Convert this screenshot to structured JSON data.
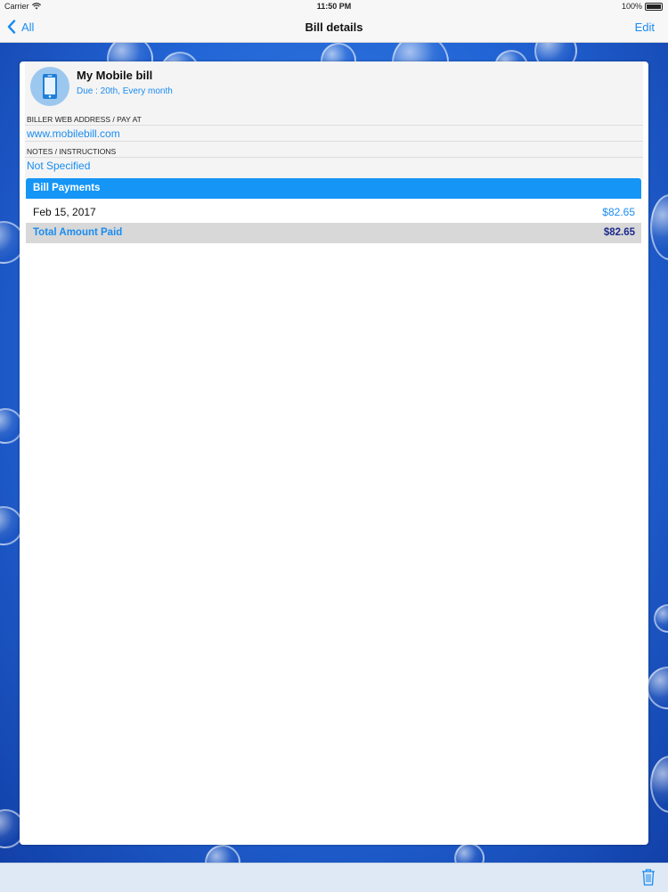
{
  "status_bar": {
    "carrier": "Carrier",
    "time": "11:50 PM",
    "battery": "100%"
  },
  "nav": {
    "back_label": "All",
    "title": "Bill details",
    "edit_label": "Edit"
  },
  "bill": {
    "name": "My Mobile bill",
    "due": "Due : 20th, Every month",
    "web_address_label": "BILLER WEB ADDRESS / PAY AT",
    "web_address": "www.mobilebill.com",
    "notes_label": "NOTES / INSTRUCTIONS",
    "notes": "Not Specified"
  },
  "payments": {
    "header": "Bill Payments",
    "rows": [
      {
        "date": "Feb 15, 2017",
        "amount": "$82.65"
      }
    ],
    "total_label": "Total Amount Paid",
    "total_amount": "$82.65"
  },
  "icons": {
    "bill_icon": "mobile-phone-icon",
    "back": "chevron-left-icon",
    "delete": "trash-icon"
  },
  "colors": {
    "accent": "#1a8cf0",
    "header_bar": "#1595f5",
    "total_amount": "#1c2a8c"
  }
}
